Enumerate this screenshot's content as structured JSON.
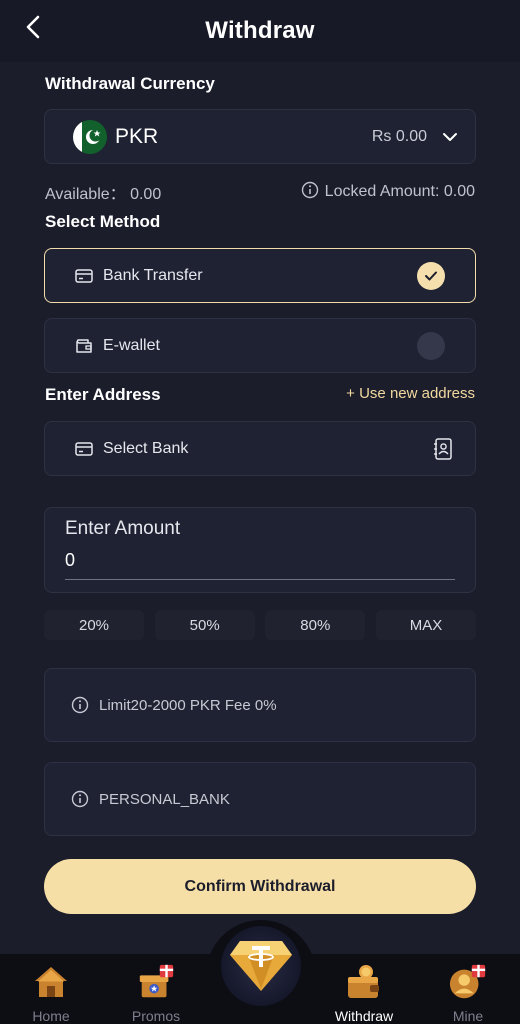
{
  "header": {
    "title": "Withdraw"
  },
  "currency": {
    "label": "Withdrawal Currency",
    "code": "PKR",
    "balance": "Rs 0.00"
  },
  "balances": {
    "available": "Available： 0.00",
    "locked": "Locked Amount: 0.00"
  },
  "method": {
    "label": "Select Method",
    "options": [
      {
        "label": "Bank Transfer",
        "selected": true
      },
      {
        "label": "E-wallet",
        "selected": false
      }
    ]
  },
  "address": {
    "label": "Enter Address",
    "use_new": "+ Use new address",
    "select_bank": "Select Bank"
  },
  "amount": {
    "label": "Enter Amount",
    "value": "0",
    "presets": [
      "20%",
      "50%",
      "80%",
      "MAX"
    ]
  },
  "notes": {
    "limit": "Limit20-2000 PKR Fee 0%",
    "channel": "PERSONAL_BANK"
  },
  "confirm_label": "Confirm Withdrawal",
  "nav": {
    "items": [
      {
        "label": "Home",
        "active": false
      },
      {
        "label": "Promos",
        "active": false
      },
      {
        "label": "Withdraw",
        "active": true
      },
      {
        "label": "Mine",
        "active": false
      }
    ]
  },
  "colors": {
    "accent": "#f6dfa6",
    "background": "#1b1d2b",
    "card": "#1f2232"
  }
}
